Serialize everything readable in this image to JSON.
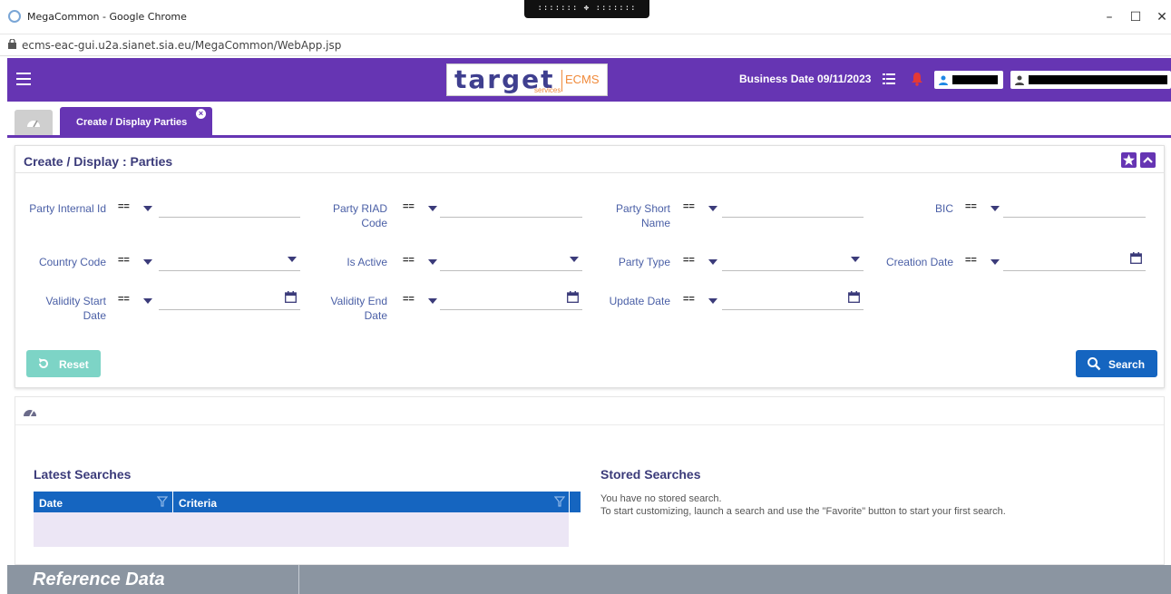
{
  "window": {
    "title": "MegaCommon - Google Chrome",
    "drag_handle": "::::::: ✥ :::::::",
    "minimize_glyph": "–",
    "maximize_glyph": "☐",
    "close_glyph": "✕"
  },
  "address_bar": {
    "url": "ecms-eac-gui.u2a.sianet.sia.eu/MegaCommon/WebApp.jsp"
  },
  "header": {
    "logo_word": "target",
    "logo_product": "ECMS",
    "logo_sub": "services",
    "business_date_label": "Business Date 09/11/2023",
    "accent_color": "#6635b3"
  },
  "tabs": {
    "home_icon": "dashboard-gauge-icon",
    "active_label": "Create / Display Parties",
    "close_glyph": "×"
  },
  "form": {
    "title": "Create / Display : Parties",
    "operator_default": "==",
    "fields": {
      "party_internal_id": {
        "label": "Party Internal Id",
        "value": ""
      },
      "party_riad_code": {
        "label": "Party RIAD Code",
        "value": ""
      },
      "party_short_name": {
        "label": "Party Short Name",
        "value": ""
      },
      "bic": {
        "label": "BIC",
        "value": ""
      },
      "country_code": {
        "label": "Country Code",
        "value": ""
      },
      "is_active": {
        "label": "Is Active",
        "value": ""
      },
      "party_type": {
        "label": "Party Type",
        "value": ""
      },
      "creation_date": {
        "label": "Creation Date",
        "value": ""
      },
      "validity_start_date": {
        "label": "Validity Start Date",
        "value": ""
      },
      "validity_end_date": {
        "label": "Validity End Date",
        "value": ""
      },
      "update_date": {
        "label": "Update Date",
        "value": ""
      }
    },
    "reset_label": "Reset",
    "search_label": "Search",
    "reset_color": "#7dd4c6",
    "search_color": "#1565c0"
  },
  "dashboard": {
    "latest_title": "Latest Searches",
    "stored_title": "Stored Searches",
    "grid_columns": [
      "Date",
      "Criteria"
    ],
    "stored_line1": "You have no stored search.",
    "stored_line2": "To start customizing, launch a search and use the \"Favorite\" button to start your first search."
  },
  "footer": {
    "section_label": "Reference Data"
  }
}
